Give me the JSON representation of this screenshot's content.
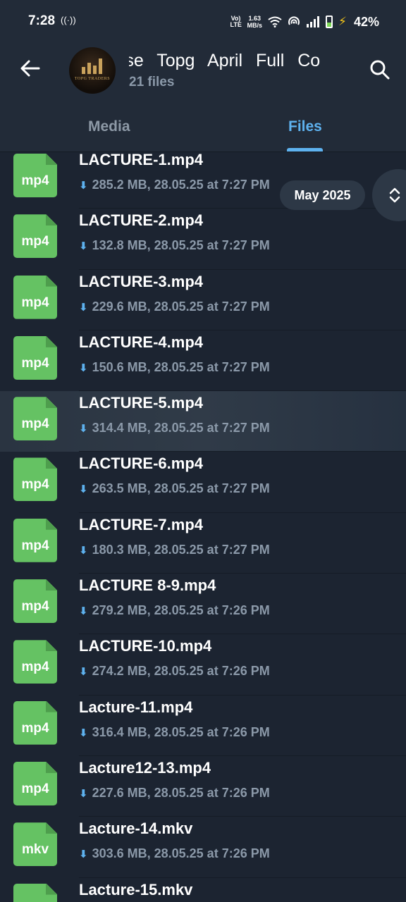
{
  "status_bar": {
    "time": "7:28",
    "hotspot_glyph": "((·))",
    "volte": "Vo) LTE",
    "speed_value": "1.63",
    "speed_unit": "MB/s",
    "battery": "42%"
  },
  "header": {
    "title": "rse   Topg April Full Co",
    "subtitle": "21 files",
    "avatar_text": "TOPG TRADERS"
  },
  "tabs": [
    {
      "label": "Media",
      "active": false
    },
    {
      "label": "Files",
      "active": true
    }
  ],
  "date_pill": "May 2025",
  "files": [
    {
      "ext": "mp4",
      "name": "LACTURE-1.mp4",
      "meta": "285.2 MB, 28.05.25 at 7:27 PM"
    },
    {
      "ext": "mp4",
      "name": "LACTURE-2.mp4",
      "meta": "132.8 MB, 28.05.25 at 7:27 PM"
    },
    {
      "ext": "mp4",
      "name": "LACTURE-3.mp4",
      "meta": "229.6 MB, 28.05.25 at 7:27 PM"
    },
    {
      "ext": "mp4",
      "name": "LACTURE-4.mp4",
      "meta": "150.6 MB, 28.05.25 at 7:27 PM"
    },
    {
      "ext": "mp4",
      "name": "LACTURE-5.mp4",
      "meta": "314.4 MB, 28.05.25 at 7:27 PM"
    },
    {
      "ext": "mp4",
      "name": "LACTURE-6.mp4",
      "meta": "263.5 MB, 28.05.25 at 7:27 PM"
    },
    {
      "ext": "mp4",
      "name": "LACTURE-7.mp4",
      "meta": "180.3 MB, 28.05.25 at 7:27 PM"
    },
    {
      "ext": "mp4",
      "name": "LACTURE 8-9.mp4",
      "meta": "279.2 MB, 28.05.25 at 7:26 PM"
    },
    {
      "ext": "mp4",
      "name": "LACTURE-10.mp4",
      "meta": "274.2 MB, 28.05.25 at 7:26 PM"
    },
    {
      "ext": "mp4",
      "name": "Lacture-11.mp4",
      "meta": "316.4 MB, 28.05.25 at 7:26 PM"
    },
    {
      "ext": "mp4",
      "name": "Lacture12-13.mp4",
      "meta": "227.6 MB, 28.05.25 at 7:26 PM"
    },
    {
      "ext": "mkv",
      "name": "Lacture-14.mkv",
      "meta": "303.6 MB, 28.05.25 at 7:26 PM"
    },
    {
      "ext": "mkv",
      "name": "Lacture-15.mkv",
      "meta": ""
    }
  ],
  "colors": {
    "background": "#1c2431",
    "header": "#222b38",
    "accent": "#5eb2ef",
    "file_icon": "#65c263",
    "muted_text": "#8b99a9"
  }
}
